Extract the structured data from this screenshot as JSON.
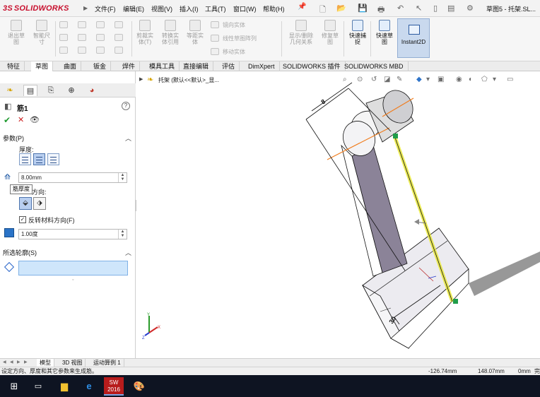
{
  "app": {
    "logo_ds": "3S",
    "logo_text": "SOLIDWORKS",
    "document_title": "草图5 - 托架.SL..."
  },
  "menu": [
    "文件(F)",
    "编辑(E)",
    "视图(V)",
    "插入(I)",
    "工具(T)",
    "窗口(W)",
    "帮助(H)"
  ],
  "command_manager": {
    "exit_sketch": "退出草\n图",
    "smart_dimension": "智能尺\n寸",
    "trim_entities": "剪裁实\n体(T)",
    "convert_entities": "转换实\n体引用",
    "offset_entities": "等距实\n体",
    "mirror_entities": "镜向实体",
    "linear_pattern": "线性草图阵列",
    "move_entities": "移动实体",
    "display_relations": "显示/删除\n几何关系",
    "repair_sketch": "修复草\n图",
    "quick_snaps": "快速捕\n捉",
    "rapid_sketch": "快速草\n图",
    "instant2d": "Instant2D"
  },
  "tabs": [
    "特征",
    "草图",
    "曲面",
    "钣金",
    "焊件",
    "模具工具",
    "直接编辑",
    "评估",
    "DimXpert",
    "SOLIDWORKS 插件",
    "SOLIDWORKS MBD"
  ],
  "active_tab": "草图",
  "property_manager": {
    "title": "筋1",
    "help": "?",
    "params_header": "参数(P)",
    "thickness_label": "厚度:",
    "thickness_value": "8.00mm",
    "tooltip": "筋厚度",
    "direction_label": "方向:",
    "reverse_label": "反转材料方向(F)",
    "reverse_checked": "✓",
    "draft_value": "1.00度",
    "profiles_header": "所选轮廓(S)"
  },
  "viewport": {
    "tree_item": "托架  (默认<<默认>_显...",
    "dim_top": "8",
    "dim_bottom": "30"
  },
  "bottom_tabs": [
    "模型",
    "3D 视图",
    "运动算例 1"
  ],
  "active_bottom_tab": "模型",
  "status": {
    "message": "设定方向、厚度和其它参数来生成筋。",
    "x": "-126.74mm",
    "y": "148.07mm",
    "z": "0mm",
    "extra": "完"
  },
  "taskbar": {
    "sw_label": "SW\n2016"
  }
}
